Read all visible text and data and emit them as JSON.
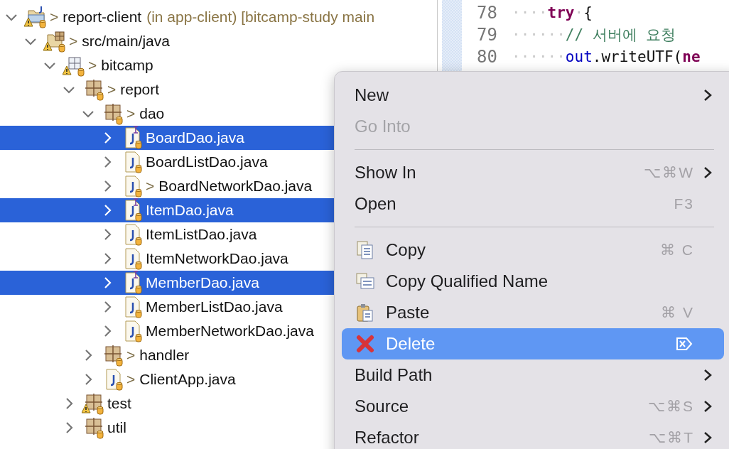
{
  "tree": [
    {
      "label": "report-client",
      "prefix": ">",
      "detail": "(in app-client) [bitcamp-study main",
      "kind": "project",
      "warning": true,
      "expanded": true,
      "selected": false,
      "children": [
        {
          "label": "src/main/java",
          "prefix": ">",
          "kind": "source-folder",
          "warning": true,
          "expanded": true,
          "selected": false,
          "children": [
            {
              "label": "bitcamp",
              "prefix": ">",
              "kind": "package-empty",
              "warning": true,
              "expanded": true,
              "selected": false,
              "children": [
                {
                  "label": "report",
                  "prefix": ">",
                  "kind": "package",
                  "warning": false,
                  "expanded": true,
                  "selected": false,
                  "children": [
                    {
                      "label": "dao",
                      "prefix": ">",
                      "kind": "package",
                      "warning": false,
                      "expanded": true,
                      "selected": false,
                      "children": [
                        {
                          "label": "BoardDao.java",
                          "kind": "interface",
                          "warning": false,
                          "expanded": false,
                          "selected": true
                        },
                        {
                          "label": "BoardListDao.java",
                          "kind": "class",
                          "warning": false,
                          "expanded": false,
                          "selected": false
                        },
                        {
                          "label": "BoardNetworkDao.java",
                          "prefix": ">",
                          "kind": "class",
                          "warning": false,
                          "expanded": false,
                          "selected": false
                        },
                        {
                          "label": "ItemDao.java",
                          "kind": "interface",
                          "warning": false,
                          "expanded": false,
                          "selected": true
                        },
                        {
                          "label": "ItemListDao.java",
                          "kind": "class",
                          "warning": false,
                          "expanded": false,
                          "selected": false
                        },
                        {
                          "label": "ItemNetworkDao.java",
                          "kind": "class",
                          "warning": false,
                          "expanded": false,
                          "selected": false
                        },
                        {
                          "label": "MemberDao.java",
                          "kind": "interface",
                          "warning": false,
                          "expanded": false,
                          "selected": true
                        },
                        {
                          "label": "MemberListDao.java",
                          "kind": "class",
                          "warning": false,
                          "expanded": false,
                          "selected": false
                        },
                        {
                          "label": "MemberNetworkDao.java",
                          "kind": "class",
                          "warning": false,
                          "expanded": false,
                          "selected": false
                        }
                      ]
                    },
                    {
                      "label": "handler",
                      "prefix": ">",
                      "kind": "package",
                      "warning": false,
                      "expanded": false,
                      "selected": false
                    },
                    {
                      "label": "ClientApp.java",
                      "prefix": ">",
                      "kind": "class",
                      "warning": false,
                      "expanded": false,
                      "selected": false
                    }
                  ]
                },
                {
                  "label": "test",
                  "kind": "package",
                  "warning": true,
                  "expanded": false,
                  "selected": false
                },
                {
                  "label": "util",
                  "kind": "package",
                  "warning": false,
                  "expanded": false,
                  "selected": false
                }
              ]
            }
          ]
        }
      ]
    }
  ],
  "editor": {
    "lines": [
      {
        "number": "78",
        "tokens": [
          {
            "kind": "ws",
            "text": "····"
          },
          {
            "kind": "keyword",
            "text": "try"
          },
          {
            "kind": "ws",
            "text": "·"
          },
          {
            "kind": "plain",
            "text": "{"
          }
        ]
      },
      {
        "number": "79",
        "tokens": [
          {
            "kind": "ws",
            "text": "······"
          },
          {
            "kind": "comment",
            "text": "// 서버에 요청"
          }
        ]
      },
      {
        "number": "80",
        "tokens": [
          {
            "kind": "ws",
            "text": "······"
          },
          {
            "kind": "field",
            "text": "out"
          },
          {
            "kind": "plain",
            "text": ".writeUTF("
          },
          {
            "kind": "keyword",
            "text": "ne"
          }
        ]
      }
    ]
  },
  "context_menu": [
    {
      "kind": "item",
      "label": "New",
      "submenu": true,
      "disabled": false,
      "selected": false
    },
    {
      "kind": "item",
      "label": "Go Into",
      "submenu": false,
      "disabled": true,
      "selected": false
    },
    {
      "kind": "separator"
    },
    {
      "kind": "item",
      "label": "Show In",
      "shortcut": "⌥⌘W",
      "submenu": true,
      "disabled": false,
      "selected": false
    },
    {
      "kind": "item",
      "label": "Open",
      "shortcut": "F3",
      "submenu": false,
      "disabled": false,
      "selected": false
    },
    {
      "kind": "separator"
    },
    {
      "kind": "copy",
      "label": "Copy",
      "shortcut": "⌘ C",
      "submenu": false,
      "disabled": false,
      "selected": false
    },
    {
      "kind": "copy-name",
      "label": "Copy Qualified Name",
      "submenu": false,
      "disabled": false,
      "selected": false
    },
    {
      "kind": "paste",
      "label": "Paste",
      "shortcut": "⌘ V",
      "submenu": false,
      "disabled": false,
      "selected": false
    },
    {
      "kind": "delete",
      "label": "Delete",
      "submenu": false,
      "disabled": false,
      "selected": true
    },
    {
      "kind": "item",
      "label": "Build Path",
      "submenu": true,
      "disabled": false,
      "selected": false
    },
    {
      "kind": "item",
      "label": "Source",
      "shortcut": "⌥⌘S",
      "submenu": true,
      "disabled": false,
      "selected": false
    },
    {
      "kind": "item",
      "label": "Refactor",
      "shortcut": "⌥⌘T",
      "submenu": true,
      "disabled": false,
      "selected": false
    }
  ]
}
